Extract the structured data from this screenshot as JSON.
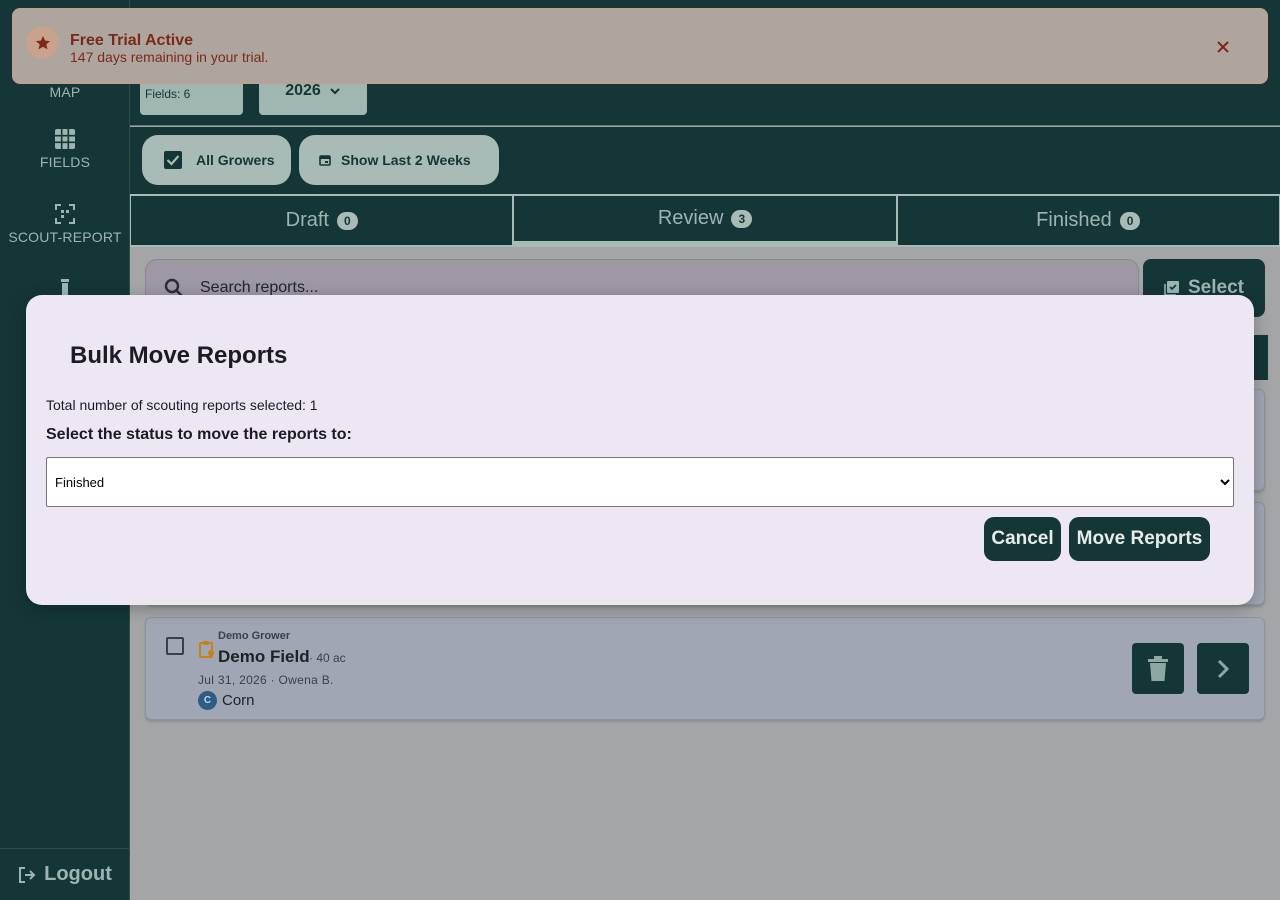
{
  "sidebar": {
    "items": [
      {
        "label": "MAP",
        "icon": "map-icon"
      },
      {
        "label": "FIELDS",
        "icon": "grid-icon"
      },
      {
        "label": "SCOUT-REPORT",
        "icon": "scan-icon"
      },
      {
        "label": "",
        "icon": "test-tube-icon"
      }
    ],
    "logout_label": "Logout"
  },
  "header": {
    "fields_label": "Fields: 6",
    "year": "2026"
  },
  "filters": {
    "all_growers": "All Growers",
    "last_two_weeks": "Show Last 2 Weeks"
  },
  "tabs": [
    {
      "label": "Draft",
      "count": "0"
    },
    {
      "label": "Review",
      "count": "3"
    },
    {
      "label": "Finished",
      "count": "0"
    }
  ],
  "search": {
    "placeholder": "Search reports...",
    "select_label": "Select"
  },
  "report": {
    "grower": "Demo Grower",
    "field": "Demo Field",
    "acres": "· 40 ac",
    "meta": "Jul 31, 2026  ·  Owena B.",
    "crop_initial": "C",
    "crop": "Corn"
  },
  "toast": {
    "title": "Free Trial Active",
    "subtitle": "147 days remaining in your trial."
  },
  "modal": {
    "title": "Bulk Move Reports",
    "count_text": "Total number of scouting reports selected: 1",
    "prompt": "Select the status to move the reports to:",
    "selected_option": "Finished",
    "cancel_label": "Cancel",
    "move_label": "Move Reports"
  },
  "colors": {
    "brand_dark": "#153636",
    "accent_light": "#a8bbb7",
    "toast_text": "#7c2a18",
    "modal_bg": "#ede7f4"
  }
}
